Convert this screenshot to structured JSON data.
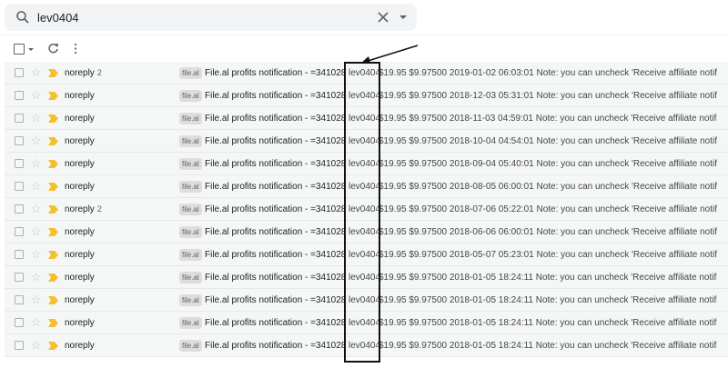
{
  "search": {
    "query": "lev0404"
  },
  "toolbar": {
    "select": "checkbox",
    "refresh": "refresh-icon",
    "more": "more-vert-icon"
  },
  "colors": {
    "important": "#f2c12e",
    "highlight_box": "#111111"
  },
  "rows": [
    {
      "sender": "noreply",
      "count": "2",
      "label": "file.al",
      "subject": "File.al profits notification - =3410287.0",
      "keyword": "lev0404",
      "snippet": "$19.95 $9.97500 2019-01-02 06:03:01 Note: you can uncheck 'Receive affiliate notifications"
    },
    {
      "sender": "noreply",
      "count": "",
      "label": "file.al",
      "subject": "File.al profits notification - =3410287.0",
      "keyword": "lev0404",
      "snippet": "$19.95 $9.97500 2018-12-03 05:31:01 Note: you can uncheck 'Receive affiliate notifications"
    },
    {
      "sender": "noreply",
      "count": "",
      "label": "file.al",
      "subject": "File.al profits notification - =3410287.0",
      "keyword": "lev0404",
      "snippet": "$19.95 $9.97500 2018-11-03 04:59:01 Note: you can uncheck 'Receive affiliate notifications"
    },
    {
      "sender": "noreply",
      "count": "",
      "label": "file.al",
      "subject": "File.al profits notification - =3410287.0",
      "keyword": "lev0404",
      "snippet": "$19.95 $9.97500 2018-10-04 04:54:01 Note: you can uncheck 'Receive affiliate notifications"
    },
    {
      "sender": "noreply",
      "count": "",
      "label": "file.al",
      "subject": "File.al profits notification - =3410287.0",
      "keyword": "lev0404",
      "snippet": "$19.95 $9.97500 2018-09-04 05:40:01 Note: you can uncheck 'Receive affiliate notifications"
    },
    {
      "sender": "noreply",
      "count": "",
      "label": "file.al",
      "subject": "File.al profits notification - =3410287.0",
      "keyword": "lev0404",
      "snippet": "$19.95 $9.97500 2018-08-05 06:00:01 Note: you can uncheck 'Receive affiliate notifications"
    },
    {
      "sender": "noreply",
      "count": "2",
      "label": "file.al",
      "subject": "File.al profits notification - =3410287.0",
      "keyword": "lev0404",
      "snippet": "$19.95 $9.97500 2018-07-06 05:22:01 Note: you can uncheck 'Receive affiliate notifications"
    },
    {
      "sender": "noreply",
      "count": "",
      "label": "file.al",
      "subject": "File.al profits notification - =3410287.0",
      "keyword": "lev0404",
      "snippet": "$19.95 $9.97500 2018-06-06 06:00:01 Note: you can uncheck 'Receive affiliate notifications"
    },
    {
      "sender": "noreply",
      "count": "",
      "label": "file.al",
      "subject": "File.al profits notification - =3410287.0",
      "keyword": "lev0404",
      "snippet": "$19.95 $9.97500 2018-05-07 05:23:01 Note: you can uncheck 'Receive affiliate notifications"
    },
    {
      "sender": "noreply",
      "count": "",
      "label": "file.al",
      "subject": "File.al profits notification - =3410287.0",
      "keyword": "lev0404",
      "snippet": "$19.95 $9.97500 2018-01-05 18:24:11 Note: you can uncheck 'Receive affiliate notifications"
    },
    {
      "sender": "noreply",
      "count": "",
      "label": "file.al",
      "subject": "File.al profits notification - =3410287.0",
      "keyword": "lev0404",
      "snippet": "$19.95 $9.97500 2018-01-05 18:24:11 Note: you can uncheck 'Receive affiliate notifications"
    },
    {
      "sender": "noreply",
      "count": "",
      "label": "file.al",
      "subject": "File.al profits notification - =3410287.0",
      "keyword": "lev0404",
      "snippet": "$19.95 $9.97500 2018-01-05 18:24:11 Note: you can uncheck 'Receive affiliate notifications"
    },
    {
      "sender": "noreply",
      "count": "",
      "label": "file.al",
      "subject": "File.al profits notification - =3410287.0",
      "keyword": "lev0404",
      "snippet": "$19.95 $9.97500 2018-01-05 18:24:11 Note: you can uncheck 'Receive affiliate notifications"
    }
  ]
}
